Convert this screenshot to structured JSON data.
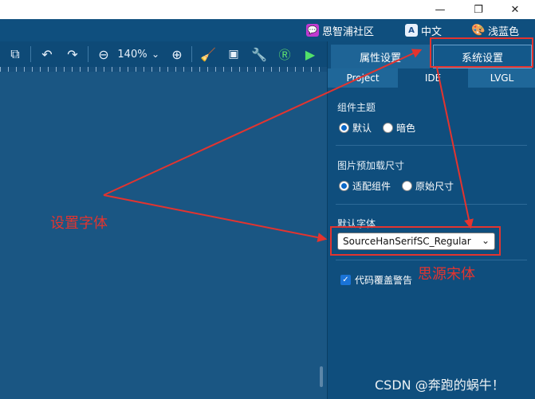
{
  "menubar": {
    "community": "恩智浦社区",
    "language": "中文",
    "theme": "浅蓝色",
    "lang_icon_text": "A"
  },
  "toolbar": {
    "zoom": "140%"
  },
  "panel": {
    "tabs": [
      "属性设置",
      "系统设置"
    ],
    "subtabs": [
      "Project",
      "IDE",
      "LVGL"
    ],
    "theme_title": "组件主题",
    "theme_options": [
      "默认",
      "暗色"
    ],
    "preload_title": "图片预加载尺寸",
    "preload_options": [
      "适配组件",
      "原始尺寸"
    ],
    "font_title": "默认字体",
    "font_value": "SourceHanSerifSC_Regular",
    "code_warning": "代码覆盖警告"
  },
  "annotations": {
    "set_font": "设置字体",
    "source_han": "思源宋体",
    "color": "#e3342f"
  },
  "watermark": "CSDN @奔跑的蜗牛！"
}
